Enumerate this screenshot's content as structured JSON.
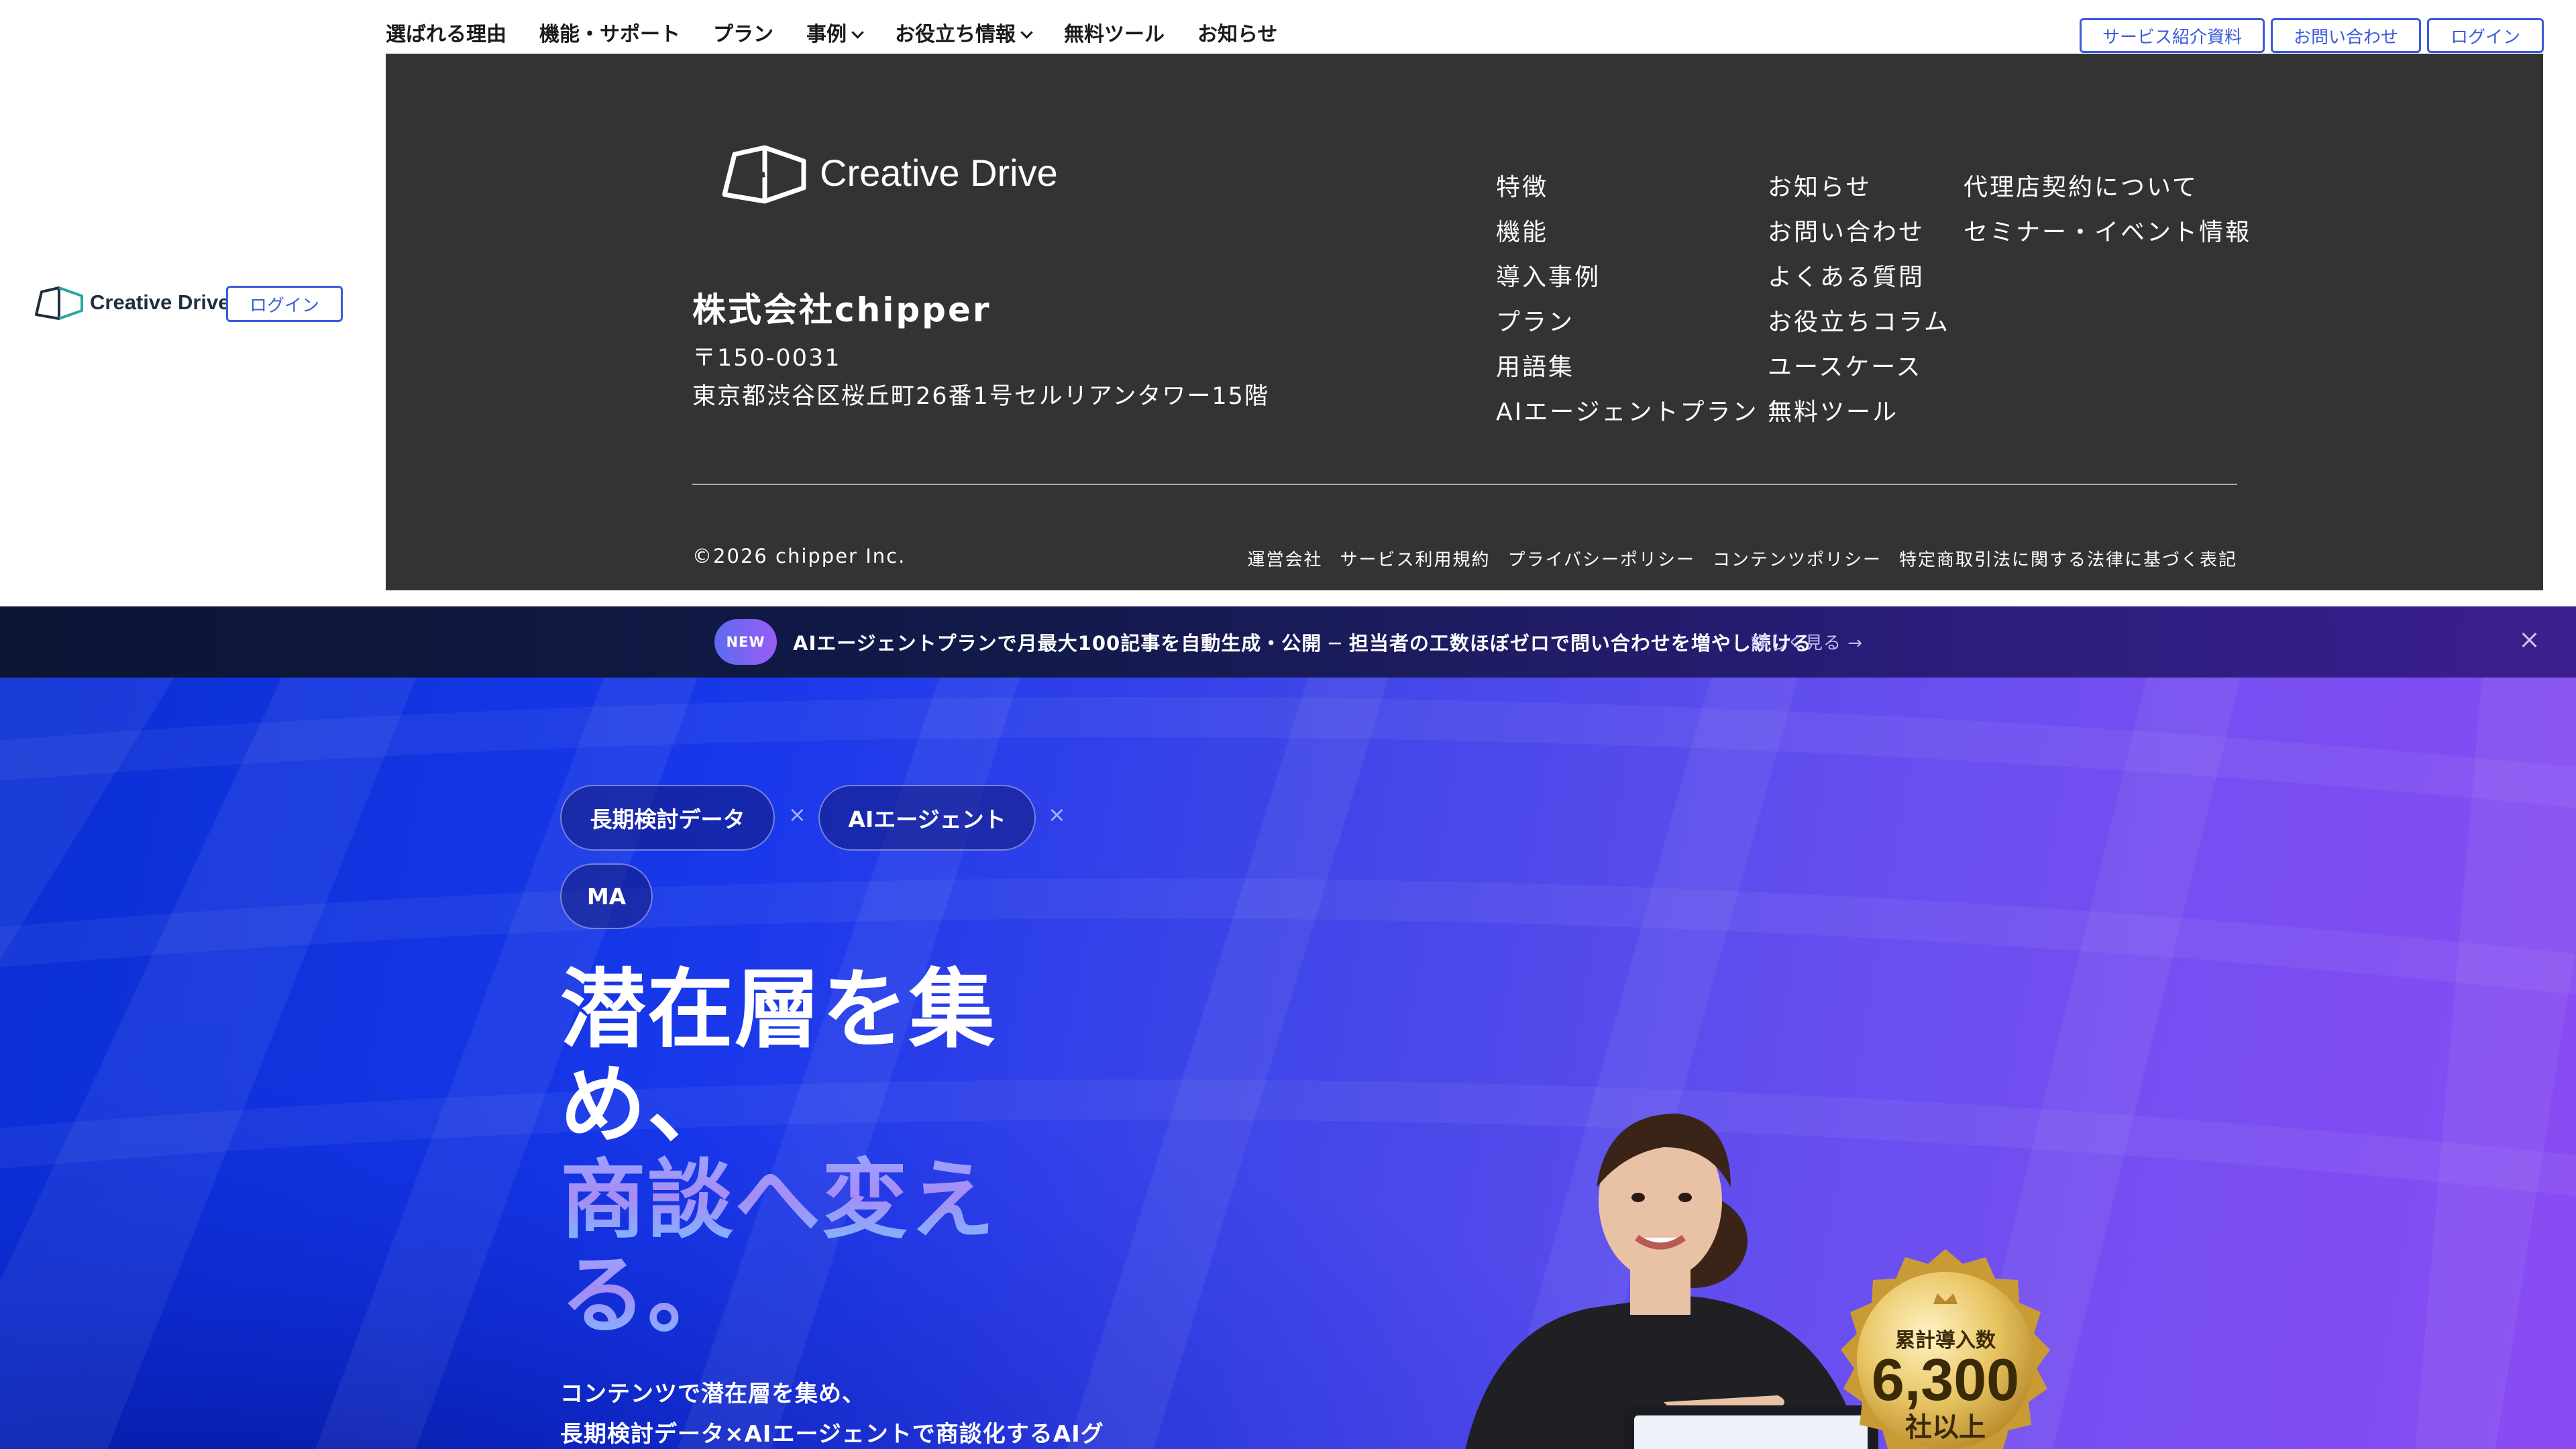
{
  "nav": {
    "items": [
      {
        "label": "選ばれる理由",
        "dropdown": false
      },
      {
        "label": "機能・サポート",
        "dropdown": false
      },
      {
        "label": "プラン",
        "dropdown": false
      },
      {
        "label": "事例",
        "dropdown": true
      },
      {
        "label": "お役立ち情報",
        "dropdown": true
      },
      {
        "label": "無料ツール",
        "dropdown": false
      },
      {
        "label": "お知らせ",
        "dropdown": false
      }
    ],
    "actions": {
      "materials": "サービス紹介資料",
      "contact": "お問い合わせ",
      "login": "ログイン"
    }
  },
  "brand": {
    "name": "Creative Drive",
    "login": "ログイン"
  },
  "footer": {
    "company": "株式会社chipper",
    "postal": "〒150-0031",
    "address": "東京都渋谷区桜丘町26番1号セルリアンタワー15階",
    "col1": [
      "特徴",
      "機能",
      "導入事例",
      "プラン",
      "用語集",
      "AIエージェントプラン"
    ],
    "col2": [
      "お知らせ",
      "お問い合わせ",
      "よくある質問",
      "お役立ちコラム",
      "ユースケース",
      "無料ツール"
    ],
    "col3": [
      "代理店契約について",
      "セミナー・イベント情報"
    ],
    "copyright": "©2026 chipper Inc.",
    "legal": [
      "運営会社",
      "サービス利用規約",
      "プライバシーポリシー",
      "コンテンツポリシー",
      "特定商取引法に関する法律に基づく表記"
    ]
  },
  "announcement": {
    "badge": "NEW",
    "text": "AIエージェントプランで月最大100記事を自動生成・公開 ─ 担当者の工数ほぼゼロで問い合わせを増やし続ける",
    "link": "詳しく見る →"
  },
  "hero": {
    "tags": [
      "長期検討データ",
      "AIエージェント",
      "MA"
    ],
    "tag_separator": "×",
    "headline": [
      "潜在層を集",
      "め、",
      "商談へ変え",
      "る。"
    ],
    "subtext": [
      "コンテンツで潜在層を集め、",
      "長期検討データ×AIエージェントで商談化するAIグ"
    ],
    "medal": {
      "title": "累計導入数",
      "number": "6,300",
      "suffix": "社以上"
    }
  },
  "colors": {
    "accent": "#3b5bdb",
    "footer_bg": "#333333",
    "hero_start": "#0a2fd4",
    "hero_end": "#8a4cf2",
    "medal_gold": "#d9b24a"
  },
  "icons": [
    "creative-drive-logo-icon",
    "chevron-down-icon",
    "close-icon",
    "crown-icon"
  ]
}
